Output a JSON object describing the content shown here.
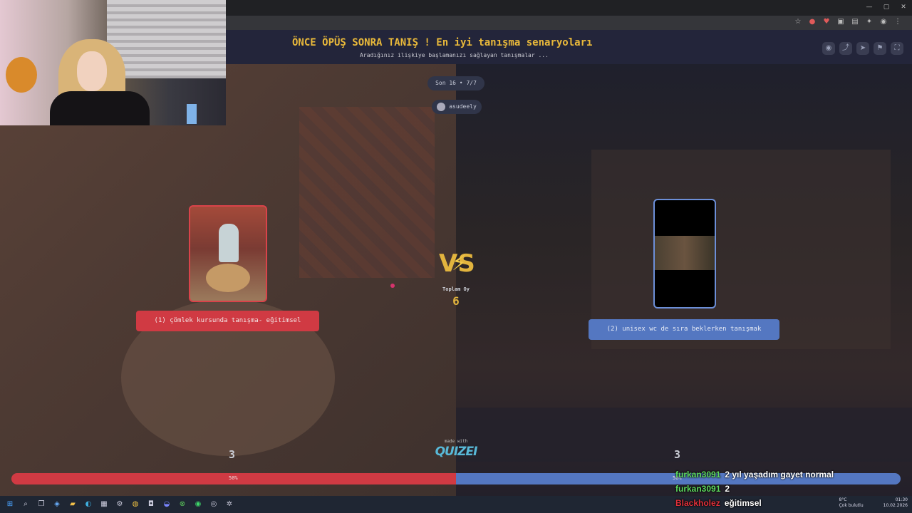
{
  "window": {
    "minimize": "—",
    "maximize": "▢",
    "close": "✕"
  },
  "site": {
    "title": "ÖNCE ÖPÜŞ SONRA TANIŞ ! En iyi tanışma senaryoları",
    "subtitle": "Aradığınız ilişkiye başlamanızı sağlayan tanışmalar ..."
  },
  "round": {
    "label": "Son 16 • 7/7"
  },
  "user": {
    "name": "asudeely"
  },
  "options": [
    {
      "label": "(1) çömlek kursunda tanışma- eğitimsel",
      "votes": "3",
      "percent": "50%",
      "percent_value": 50,
      "color": "#d03a43"
    },
    {
      "label": "(2) unisex wc de sıra beklerken tanışmak",
      "votes": "3",
      "percent": "50%",
      "percent_value": 50,
      "color": "#5477c1"
    }
  ],
  "vs": {
    "text": "VS"
  },
  "total": {
    "label": "Toplam Oy",
    "value": "6"
  },
  "footer": {
    "made_with": "made with",
    "brand": "QUIZEI"
  },
  "chat": [
    {
      "user": "furkan3091",
      "user_color": "#5fdc5f",
      "message": "2 yıl yaşadım gayet normal"
    },
    {
      "user": "furkan3091",
      "user_color": "#5fdc5f",
      "message": "2"
    },
    {
      "user": "Blackholez",
      "user_color": "#e0303a",
      "message": "eğitimsel"
    }
  ],
  "tray": {
    "weather_temp": "8°C",
    "weather_desc": "Çok bulutlu",
    "time": "01:30",
    "date": "10.02.2026"
  }
}
